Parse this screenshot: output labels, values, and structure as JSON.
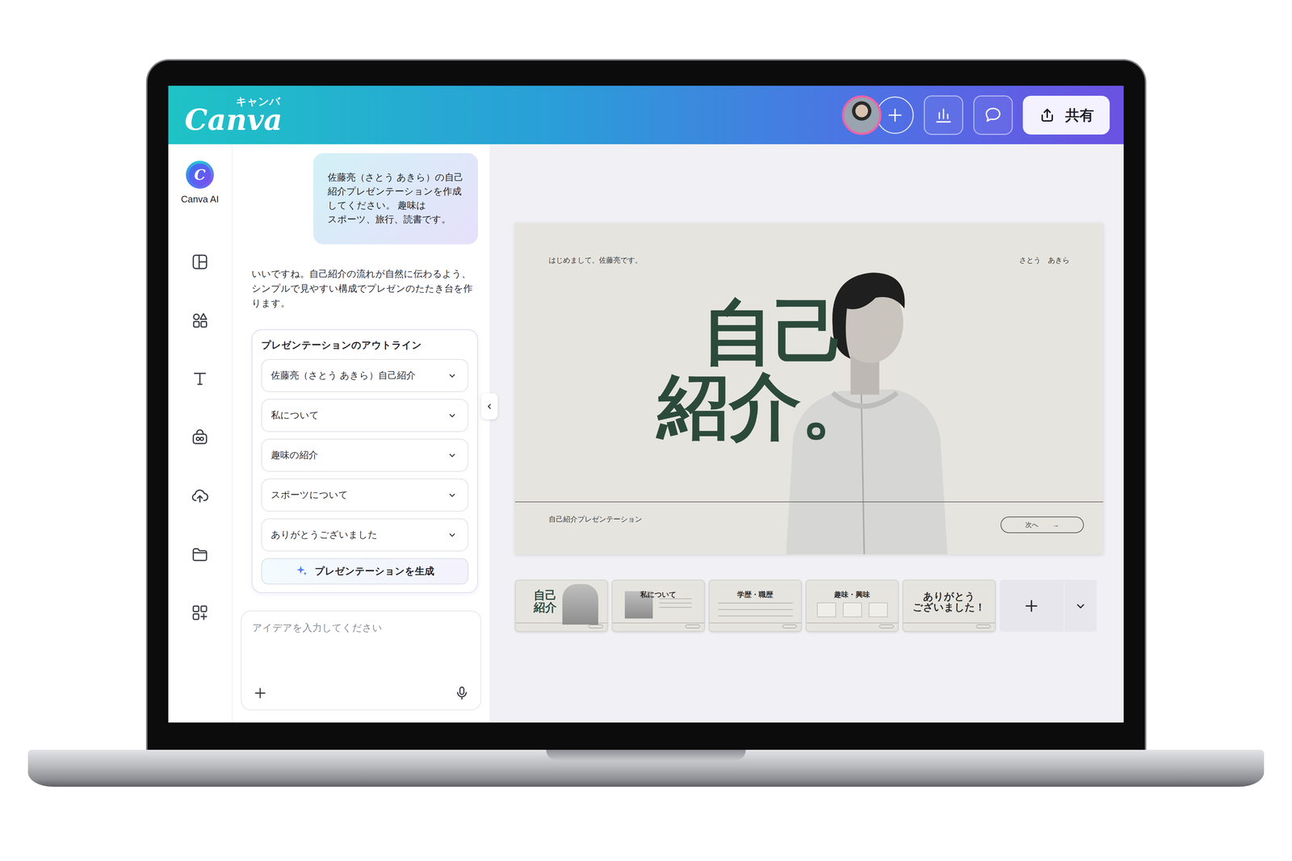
{
  "app": {
    "logo": "Canva",
    "logo_kana": "キャンバ"
  },
  "header": {
    "share": "共有"
  },
  "rail": {
    "ai_label": "Canva AI",
    "ai_letter": "C"
  },
  "chat": {
    "user_message": "佐藤亮（さとう あきら）の自己\n紹介プレゼンテーションを作成\nしてください。 趣味は\nスポーツ、旅行、読書です。",
    "ai_message": "いいですね。自己紹介の流れが自然に伝わるよう、シンプルで見やすい構成でプレゼンのたたき台を作ります。",
    "outline": {
      "title": "プレゼンテーションのアウトライン",
      "items": [
        {
          "label": "佐藤亮（さとう あきら）自己紹介",
          "expanded": false
        },
        {
          "label": "私について",
          "expanded": false
        },
        {
          "label": "趣味の紹介",
          "expanded": false
        },
        {
          "label": "スポーツについて",
          "expanded": false
        },
        {
          "label": "ありがとうございました",
          "expanded": false
        }
      ],
      "generate": "プレゼンテーションを生成"
    },
    "input": {
      "placeholder": "アイデアを入力してください"
    }
  },
  "slide": {
    "greeting": "はじめまして。佐藤亮です。",
    "reading": "さとう　あきら",
    "title": [
      "自己",
      "紹介。"
    ],
    "subtitle": "自己紹介プレゼンテーション",
    "next": {
      "label": "次へ",
      "arrow": "→"
    }
  },
  "thumbnails": [
    {
      "kind": "title",
      "lines": [
        "自己",
        "紹介"
      ]
    },
    {
      "kind": "profile",
      "lines": [
        "私について"
      ]
    },
    {
      "kind": "table",
      "lines": [
        "学歴・職歴"
      ]
    },
    {
      "kind": "cards",
      "lines": [
        "趣味・興味"
      ]
    },
    {
      "kind": "closing",
      "lines": [
        "ありがとう",
        "ございました！"
      ]
    }
  ]
}
